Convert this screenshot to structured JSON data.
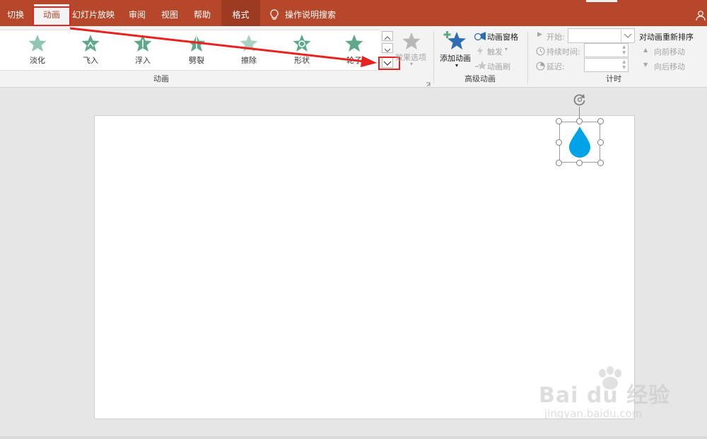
{
  "tabs": {
    "switch": "切换",
    "animation": "动画",
    "slideshow": "幻灯片放映",
    "review": "审阅",
    "view": "视图",
    "help": "帮助",
    "format": "格式",
    "tell_me": "操作说明搜索"
  },
  "animations": [
    {
      "label": "淡化",
      "icon": "fade-star-icon"
    },
    {
      "label": "飞入",
      "icon": "fly-in-star-icon"
    },
    {
      "label": "浮入",
      "icon": "float-in-star-icon"
    },
    {
      "label": "劈裂",
      "icon": "split-star-icon"
    },
    {
      "label": "擦除",
      "icon": "wipe-star-icon"
    },
    {
      "label": "形状",
      "icon": "shape-star-icon"
    },
    {
      "label": "轮子",
      "icon": "wheel-star-icon"
    }
  ],
  "effect_options": "效果选项",
  "groups": {
    "animation": "动画",
    "advanced": "高级动画",
    "timing": "计时"
  },
  "advanced": {
    "add_animation": "添加动画",
    "animation_pane": "动画窗格",
    "trigger": "触发",
    "animation_painter": "动画刷"
  },
  "timing": {
    "start": "开始:",
    "duration": "持续时间:",
    "delay": "延迟:",
    "reorder_title": "对动画重新排序",
    "move_earlier": "向前移动",
    "move_later": "向后移动"
  },
  "watermark": {
    "brand": "Bai du 经验",
    "url": "jingyan.baidu.com"
  },
  "colors": {
    "accent": "#b7472a",
    "annotation": "#e8231f",
    "star_green": "#5fa88a",
    "shape_blue": "#00a2e8"
  }
}
